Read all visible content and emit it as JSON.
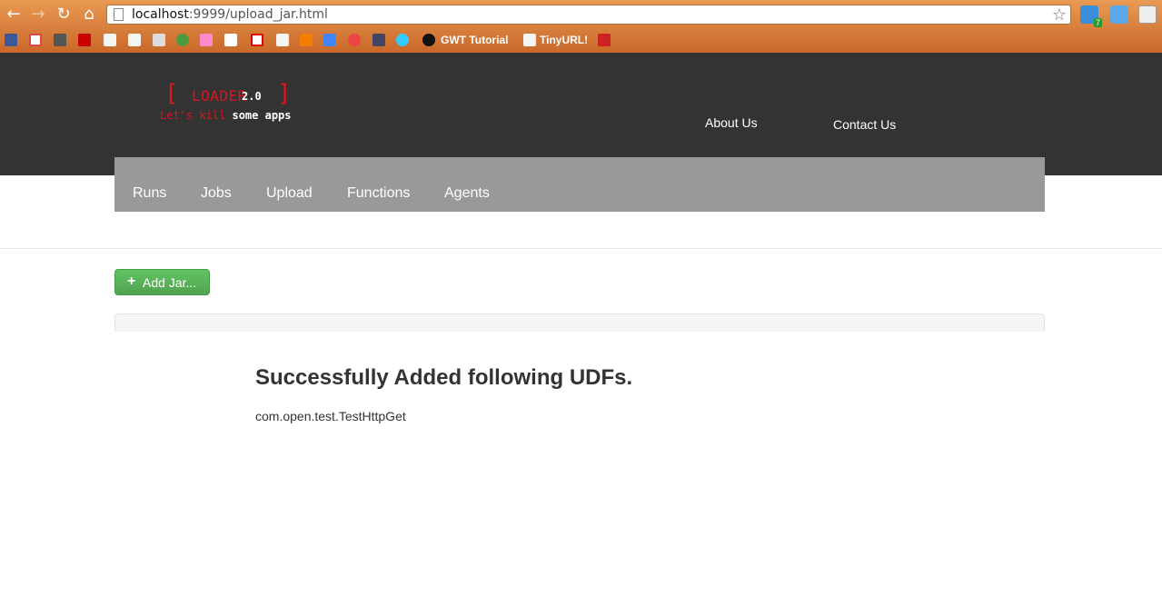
{
  "browser": {
    "url_host": "localhost",
    "url_rest": ":9999/upload_jar.html",
    "extension_badge": "7",
    "bookmarks": [
      {
        "label": "GWT Tutorial"
      },
      {
        "label": "TinyURL!"
      }
    ]
  },
  "logo": {
    "bracket_left": "[",
    "bracket_right": "]",
    "name": "LOADER",
    "version": "2.0",
    "tagline_red": "Let's kill",
    "tagline_white": "some apps"
  },
  "header_links": {
    "about": "About Us",
    "contact": "Contact Us"
  },
  "nav": {
    "items": [
      "Runs",
      "Jobs",
      "Upload",
      "Functions",
      "Agents"
    ]
  },
  "actions": {
    "add_jar_icon": "+",
    "add_jar": "Add Jar..."
  },
  "result": {
    "title": "Successfully Added following UDFs.",
    "items": [
      "com.open.test.TestHttpGet"
    ]
  },
  "colors": {
    "header_bg": "#333333",
    "nav_bg": "#999999",
    "brand_red": "#d9161c",
    "button_green": "#5bb75b"
  }
}
